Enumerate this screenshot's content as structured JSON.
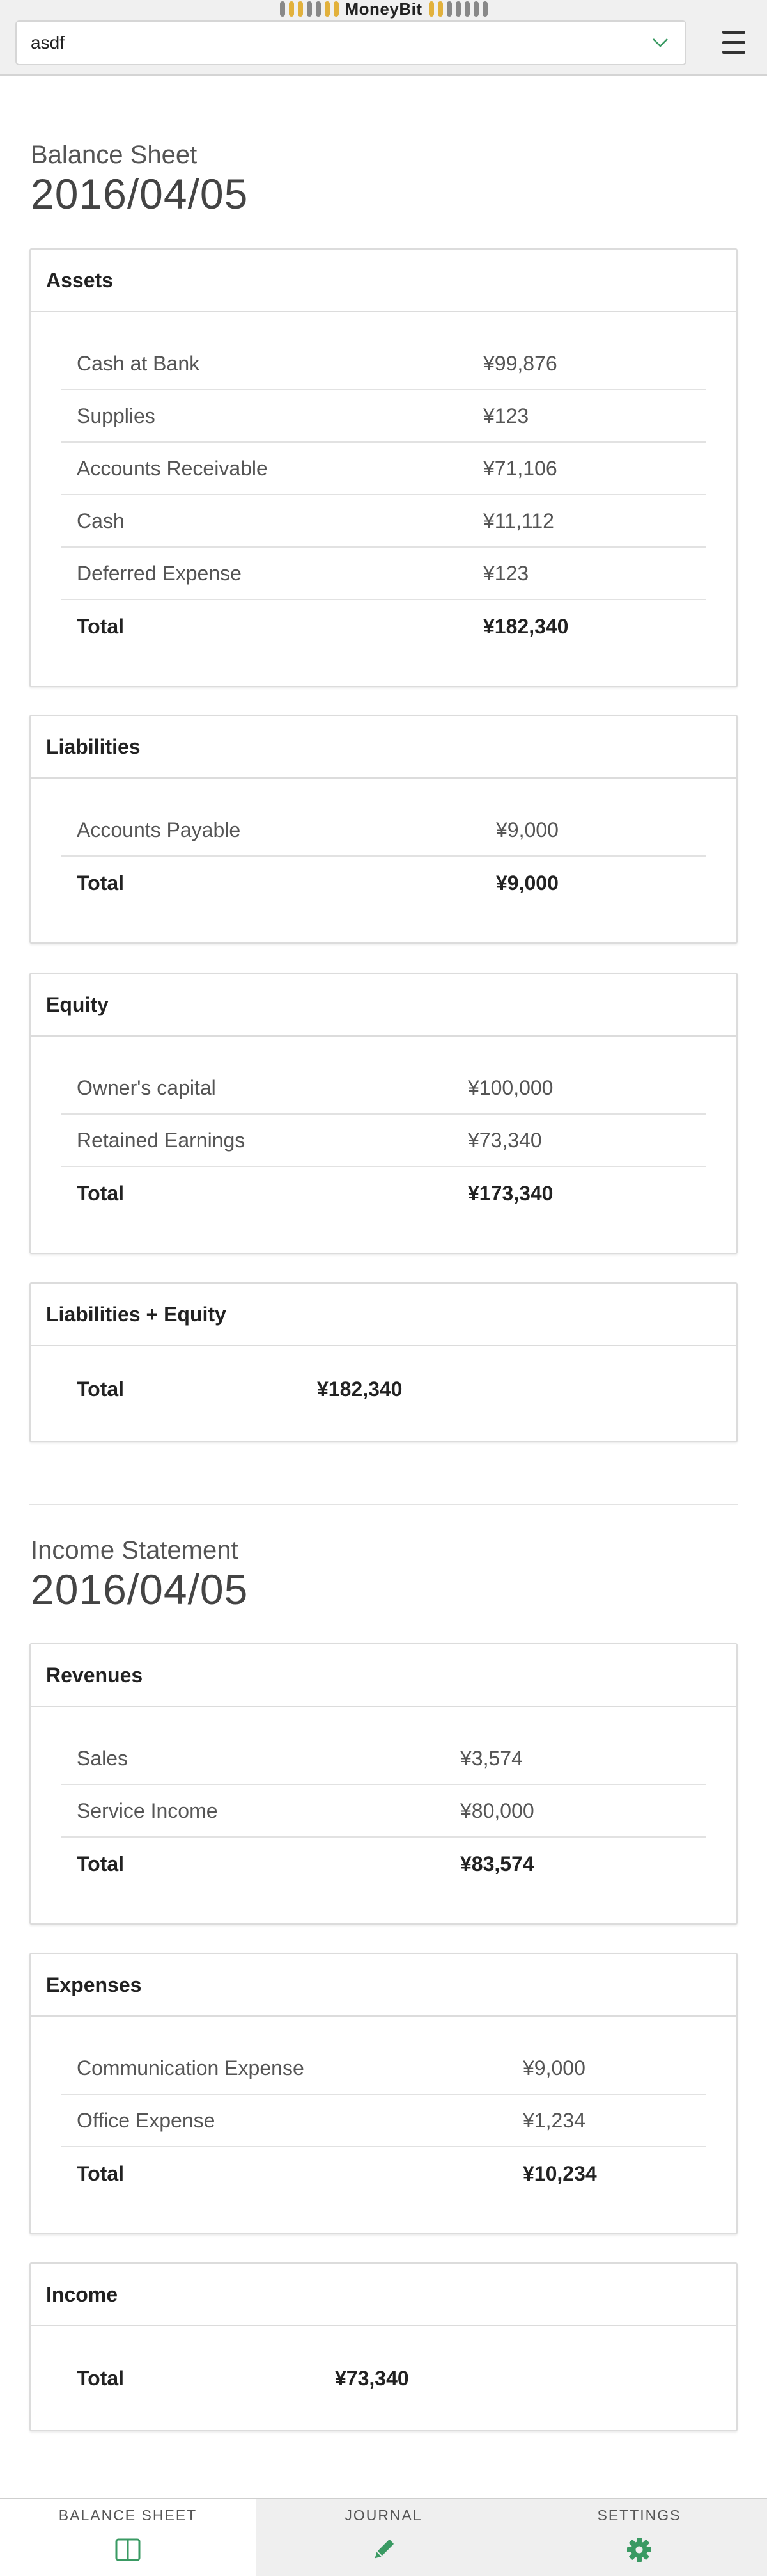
{
  "app": {
    "brand": "MoneyBit",
    "book_selector_value": "asdf"
  },
  "colors": {
    "accent_green": "#3a9a63",
    "brand_yellow": "#e2b13c",
    "brand_gray": "#888888"
  },
  "balance_sheet": {
    "title": "Balance Sheet",
    "date": "2016/04/05",
    "panels": [
      {
        "header": "Assets",
        "rows": [
          {
            "name": "Cash at Bank",
            "amount": "¥99,876"
          },
          {
            "name": "Supplies",
            "amount": "¥123"
          },
          {
            "name": "Accounts Receivable",
            "amount": "¥71,106"
          },
          {
            "name": "Cash",
            "amount": "¥11,112"
          },
          {
            "name": "Deferred Expense",
            "amount": "¥123"
          }
        ],
        "total_label": "Total",
        "total": "¥182,340"
      },
      {
        "header": "Liabilities",
        "rows": [
          {
            "name": "Accounts Payable",
            "amount": "¥9,000"
          }
        ],
        "total_label": "Total",
        "total": "¥9,000"
      },
      {
        "header": "Equity",
        "rows": [
          {
            "name": "Owner's capital",
            "amount": "¥100,000"
          },
          {
            "name": "Retained Earnings",
            "amount": "¥73,340"
          }
        ],
        "total_label": "Total",
        "total": "¥173,340"
      },
      {
        "header": "Liabilities + Equity",
        "rows": [],
        "total_label": "Total",
        "total": "¥182,340"
      }
    ]
  },
  "income_statement": {
    "title": "Income Statement",
    "date": "2016/04/05",
    "panels": [
      {
        "header": "Revenues",
        "rows": [
          {
            "name": "Sales",
            "amount": "¥3,574"
          },
          {
            "name": "Service Income",
            "amount": "¥80,000"
          }
        ],
        "total_label": "Total",
        "total": "¥83,574"
      },
      {
        "header": "Expenses",
        "rows": [
          {
            "name": "Communication Expense",
            "amount": "¥9,000"
          },
          {
            "name": "Office Expense",
            "amount": "¥1,234"
          }
        ],
        "total_label": "Total",
        "total": "¥10,234"
      },
      {
        "header": "Income",
        "rows": [],
        "total_label": "Total",
        "total": "¥73,340"
      }
    ]
  },
  "bottom_nav": {
    "items": [
      {
        "label": "BALANCE SHEET",
        "icon": "columns-icon"
      },
      {
        "label": "JOURNAL",
        "icon": "pencil-icon"
      },
      {
        "label": "SETTINGS",
        "icon": "gear-icon"
      }
    ]
  }
}
